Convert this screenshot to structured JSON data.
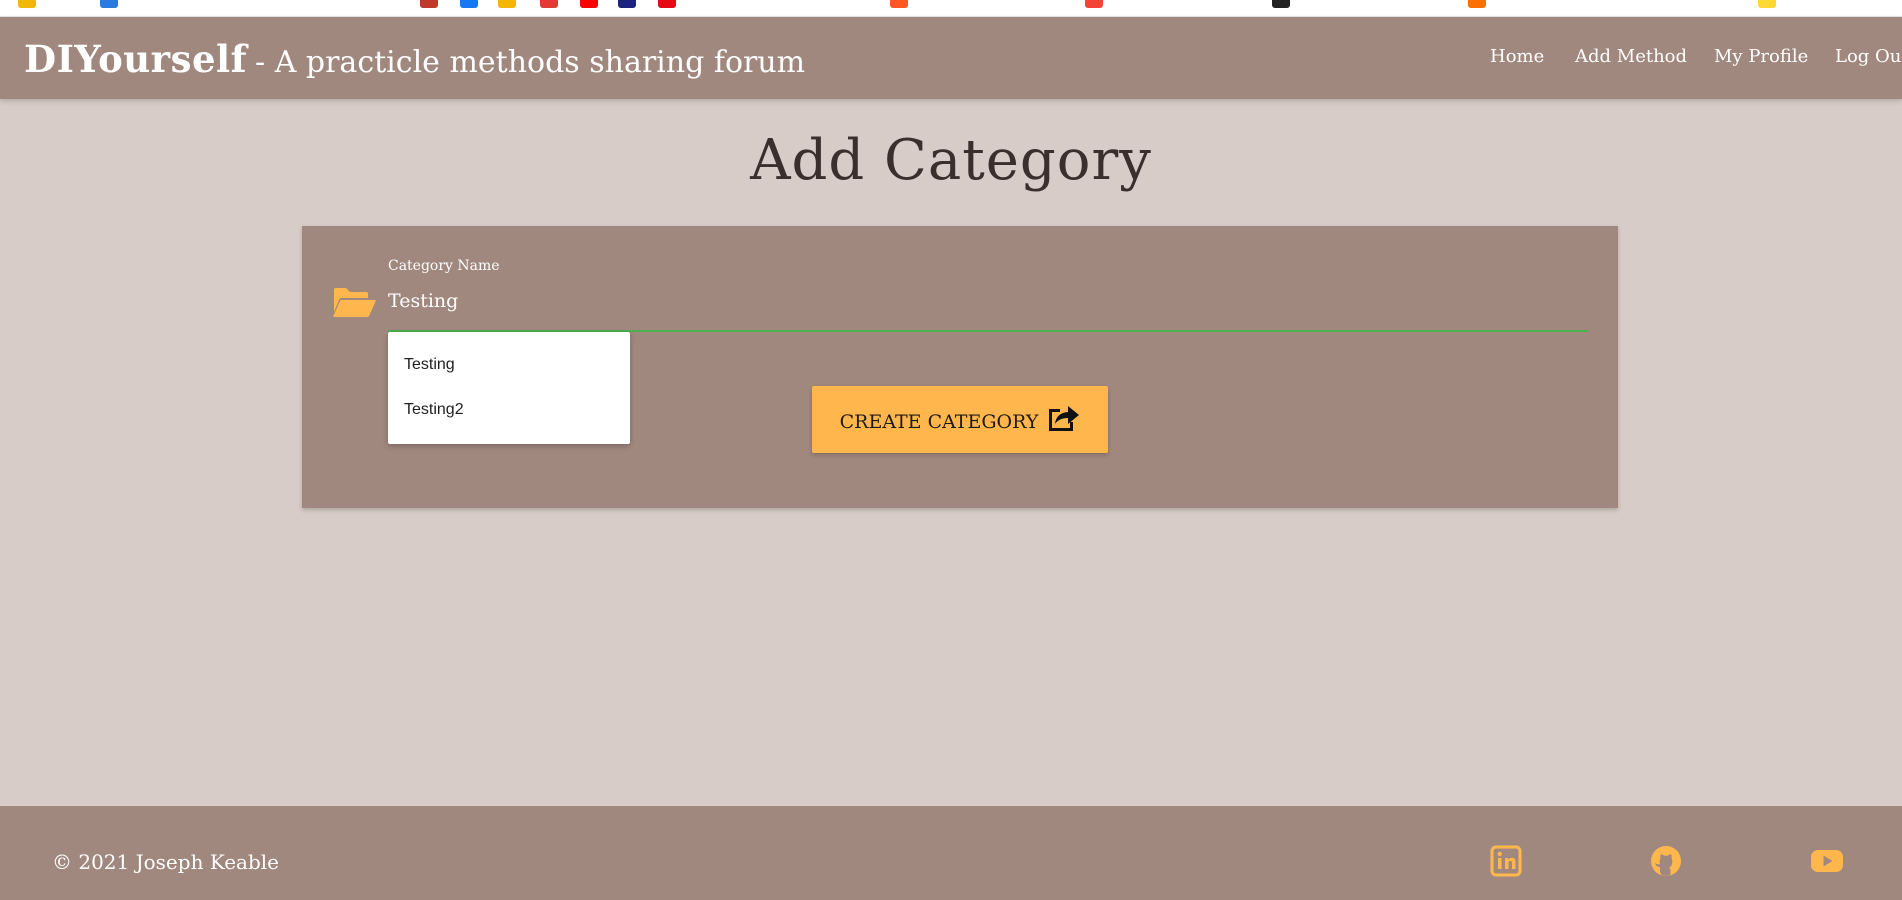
{
  "navbar": {
    "brand": "DIYourself",
    "tagline": "- A practicle methods sharing forum",
    "links": [
      {
        "label": "Home"
      },
      {
        "label": "Add Method"
      },
      {
        "label": "My Profile"
      },
      {
        "label": "Log Out"
      }
    ]
  },
  "page": {
    "title": "Add Category"
  },
  "form": {
    "icon": "folder-open-icon",
    "category_label": "Category Name",
    "category_value": "Testing",
    "autocomplete": [
      "Testing",
      "Testing2"
    ],
    "submit_label": "Create Category",
    "submit_icon": "share-square-icon"
  },
  "footer": {
    "copyright": "© 2021 Joseph Keable",
    "social": [
      "linkedin-icon",
      "github-icon",
      "youtube-icon"
    ]
  },
  "colors": {
    "background": "#d7ccc8",
    "navbar": "#a1887f",
    "accent": "#ffb74d",
    "input_focus": "#4caf50"
  }
}
